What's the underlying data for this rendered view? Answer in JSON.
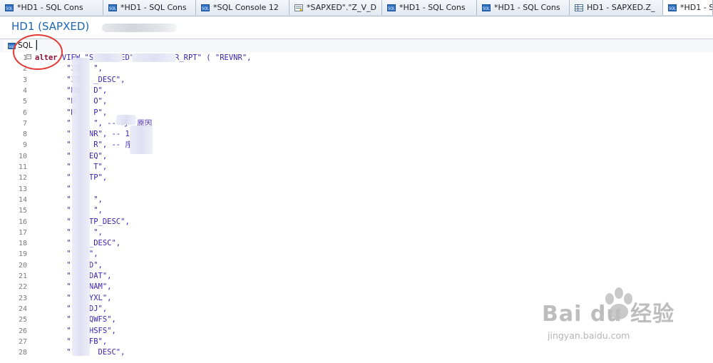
{
  "tabs": [
    {
      "label": "*HD1 - SQL Cons",
      "icon": "sql-console-icon",
      "width": 145
    },
    {
      "label": "*HD1 - SQL Cons",
      "icon": "sql-console-icon",
      "width": 130
    },
    {
      "label": "*SQL Console 12",
      "icon": "sql-console-icon",
      "width": 131
    },
    {
      "label": "*SAPXED\".\"Z_V_D",
      "icon": "view-definition-icon",
      "width": 130
    },
    {
      "label": "*HD1 - SQL Cons",
      "icon": "sql-console-icon",
      "width": 133
    },
    {
      "label": "*HD1 - SQL Cons",
      "icon": "sql-console-icon",
      "width": 130
    },
    {
      "label": "HD1 - SAPXED.Z_",
      "icon": "table-definition-icon",
      "width": 131
    },
    {
      "label": "*HD1 - S",
      "icon": "sql-console-icon",
      "width": 70,
      "active": true
    }
  ],
  "editor": {
    "title": "HD1 (SAPXED)",
    "subtab_label": "SQL"
  },
  "code_lines": [
    {
      "n": "1",
      "parts": [
        [
          "kw",
          "alter"
        ],
        [
          "str",
          " VIEW \"S"
        ],
        [
          "str",
          "      "
        ],
        [
          "str",
          "ED\""
        ],
        [
          "str",
          "         "
        ],
        [
          "str",
          "R_RPT\" ( \"REVNR\","
        ]
      ]
    },
    {
      "n": "2",
      "parts": [
        [
          "str",
          "       \"ZX"
        ],
        [
          "str",
          "   "
        ],
        [
          "str",
          "\","
        ]
      ]
    },
    {
      "n": "3",
      "parts": [
        [
          "str",
          "       \"ZX"
        ],
        [
          "str",
          "   "
        ],
        [
          "str",
          "_DESC\","
        ]
      ]
    },
    {
      "n": "4",
      "parts": [
        [
          "str",
          "       \"NE"
        ],
        [
          "str",
          "   "
        ],
        [
          "str",
          "D\","
        ]
      ]
    },
    {
      "n": "5",
      "parts": [
        [
          "str",
          "       \"N"
        ],
        [
          "str",
          "    "
        ],
        [
          "str",
          "O\","
        ]
      ]
    },
    {
      "n": "6",
      "parts": [
        [
          "str",
          "       \"M"
        ],
        [
          "str",
          "    "
        ],
        [
          "str",
          "P\","
        ]
      ]
    },
    {
      "n": "7",
      "parts": [
        [
          "str",
          "       \""
        ],
        [
          "str",
          "     "
        ],
        [
          "cm",
          "\", -- 可"
        ],
        [
          "cm",
          "  "
        ],
        [
          "cm",
          "原因"
        ]
      ]
    },
    {
      "n": "8",
      "parts": [
        [
          "str",
          "       \""
        ],
        [
          "str",
          "    "
        ],
        [
          "cm",
          "NR\", -- 1"
        ]
      ]
    },
    {
      "n": "9",
      "parts": [
        [
          "str",
          "       \""
        ],
        [
          "str",
          "     "
        ],
        [
          "cm",
          "R\", -- 序"
        ]
      ]
    },
    {
      "n": "10",
      "parts": [
        [
          "str",
          "       \""
        ],
        [
          "str",
          "    "
        ],
        [
          "str",
          "EQ\","
        ]
      ]
    },
    {
      "n": "11",
      "parts": [
        [
          "str",
          "       \""
        ],
        [
          "str",
          "     "
        ],
        [
          "str",
          "T\","
        ]
      ]
    },
    {
      "n": "12",
      "parts": [
        [
          "str",
          "       \""
        ],
        [
          "str",
          "    "
        ],
        [
          "str",
          "TP\","
        ]
      ]
    },
    {
      "n": "13",
      "parts": [
        [
          "str",
          "       \""
        ],
        [
          "str",
          "      "
        ]
      ]
    },
    {
      "n": "14",
      "parts": [
        [
          "str",
          "       \""
        ],
        [
          "str",
          "     "
        ],
        [
          "str",
          "\","
        ]
      ]
    },
    {
      "n": "15",
      "parts": [
        [
          "str",
          "       \""
        ],
        [
          "str",
          "     "
        ],
        [
          "str",
          "\","
        ]
      ]
    },
    {
      "n": "16",
      "parts": [
        [
          "str",
          "       \""
        ],
        [
          "str",
          "    "
        ],
        [
          "str",
          "TP_DESC\","
        ]
      ]
    },
    {
      "n": "17",
      "parts": [
        [
          "str",
          "       \""
        ],
        [
          "str",
          "     "
        ],
        [
          "str",
          "\","
        ]
      ]
    },
    {
      "n": "18",
      "parts": [
        [
          "str",
          "       \""
        ],
        [
          "str",
          "    "
        ],
        [
          "str",
          "_DESC\","
        ]
      ]
    },
    {
      "n": "19",
      "parts": [
        [
          "str",
          "       \""
        ],
        [
          "str",
          "    "
        ],
        [
          "str",
          "\","
        ]
      ]
    },
    {
      "n": "20",
      "parts": [
        [
          "str",
          "       \""
        ],
        [
          "str",
          "    "
        ],
        [
          "str",
          "D\","
        ]
      ]
    },
    {
      "n": "21",
      "parts": [
        [
          "str",
          "       \""
        ],
        [
          "str",
          "    "
        ],
        [
          "str",
          "DAT\","
        ]
      ]
    },
    {
      "n": "22",
      "parts": [
        [
          "str",
          "       \""
        ],
        [
          "str",
          "    "
        ],
        [
          "str",
          "NAM\","
        ]
      ]
    },
    {
      "n": "23",
      "parts": [
        [
          "str",
          "       \""
        ],
        [
          "str",
          "    "
        ],
        [
          "str",
          "YXL\","
        ]
      ]
    },
    {
      "n": "24",
      "parts": [
        [
          "str",
          "       \""
        ],
        [
          "str",
          "    "
        ],
        [
          "str",
          "DJ\","
        ]
      ]
    },
    {
      "n": "25",
      "parts": [
        [
          "str",
          "       \""
        ],
        [
          "str",
          "    "
        ],
        [
          "str",
          "QWFS\","
        ]
      ]
    },
    {
      "n": "26",
      "parts": [
        [
          "str",
          "       \""
        ],
        [
          "str",
          "    "
        ],
        [
          "str",
          "HSFS\","
        ]
      ]
    },
    {
      "n": "27",
      "parts": [
        [
          "str",
          "       \""
        ],
        [
          "str",
          "    "
        ],
        [
          "str",
          "FB\","
        ]
      ]
    },
    {
      "n": "28",
      "parts": [
        [
          "str",
          "       \""
        ],
        [
          "str",
          "      "
        ],
        [
          "str",
          "DESC\","
        ]
      ]
    }
  ],
  "watermark": {
    "brand": "Bai du 经验",
    "url": "jingyan.baidu.com"
  },
  "colors": {
    "title_blue": "#1a66b3",
    "keyword": "#8a0e35",
    "string": "#3a1fb5",
    "annotation_red": "#e23a35"
  }
}
